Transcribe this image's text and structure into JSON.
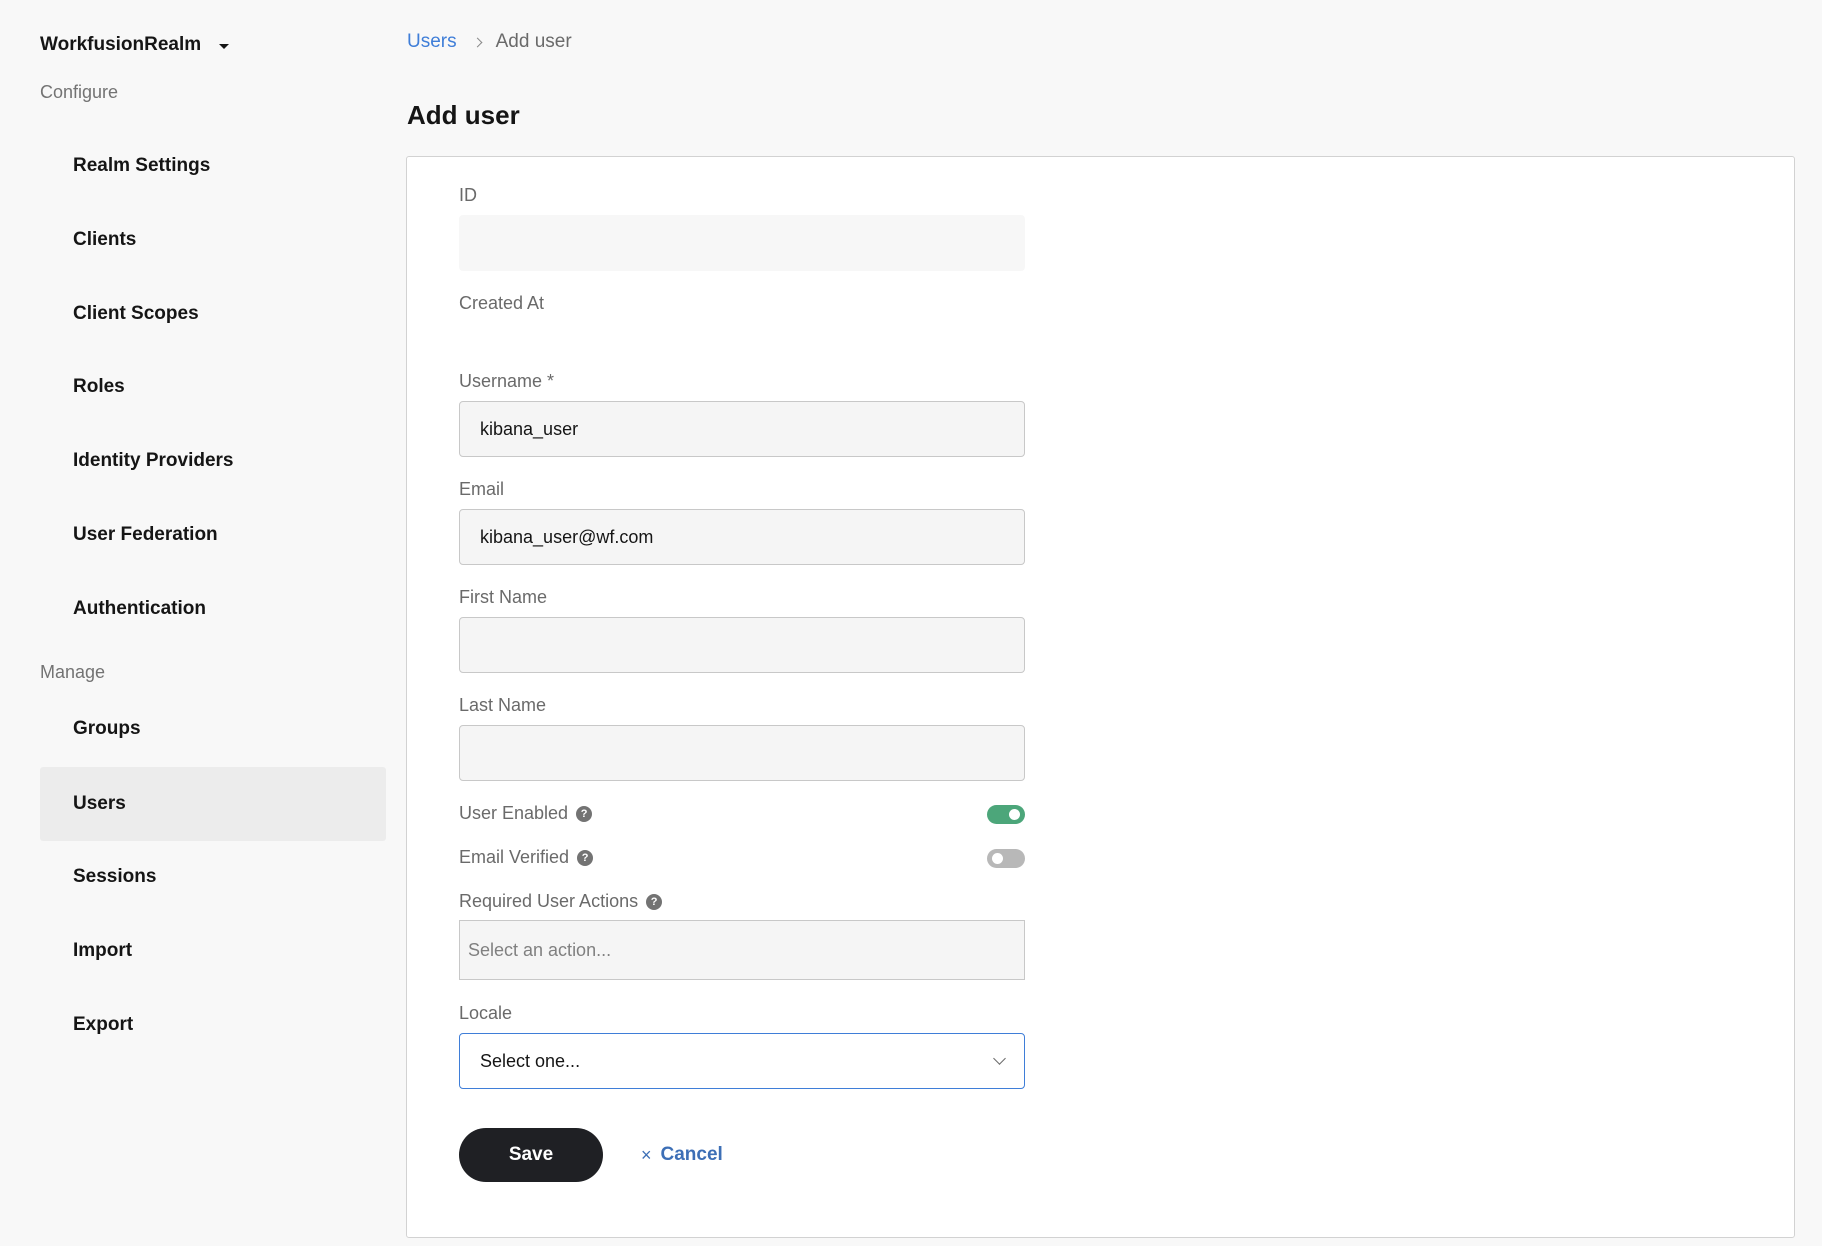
{
  "sidebar": {
    "realm_name": "WorkfusionRealm",
    "configure_label": "Configure",
    "manage_label": "Manage",
    "configure_items": [
      {
        "label": "Realm Settings"
      },
      {
        "label": "Clients"
      },
      {
        "label": "Client Scopes"
      },
      {
        "label": "Roles"
      },
      {
        "label": "Identity Providers"
      },
      {
        "label": "User Federation"
      },
      {
        "label": "Authentication"
      }
    ],
    "manage_items": [
      {
        "label": "Groups"
      },
      {
        "label": "Users",
        "active": true
      },
      {
        "label": "Sessions"
      },
      {
        "label": "Import"
      },
      {
        "label": "Export"
      }
    ]
  },
  "breadcrumb": {
    "parent": "Users",
    "current": "Add user"
  },
  "page": {
    "title": "Add user"
  },
  "form": {
    "id_label": "ID",
    "id_value": "",
    "created_at_label": "Created At",
    "username_label": "Username *",
    "username_value": "kibana_user",
    "email_label": "Email",
    "email_value": "kibana_user@wf.com",
    "first_name_label": "First Name",
    "first_name_value": "",
    "last_name_label": "Last Name",
    "last_name_value": "",
    "user_enabled_label": "User Enabled",
    "user_enabled": true,
    "email_verified_label": "Email Verified",
    "email_verified": false,
    "required_actions_label": "Required User Actions",
    "required_actions_placeholder": "Select an action...",
    "locale_label": "Locale",
    "locale_value": "Select one...",
    "help_glyph": "?",
    "save_label": "Save",
    "cancel_label": "Cancel",
    "cancel_glyph": "×"
  },
  "colors": {
    "accent_link": "#3f7ed8",
    "toggle_on": "#4ca67a",
    "toggle_off": "#b8b8b8",
    "save_button": "#1f2024"
  }
}
